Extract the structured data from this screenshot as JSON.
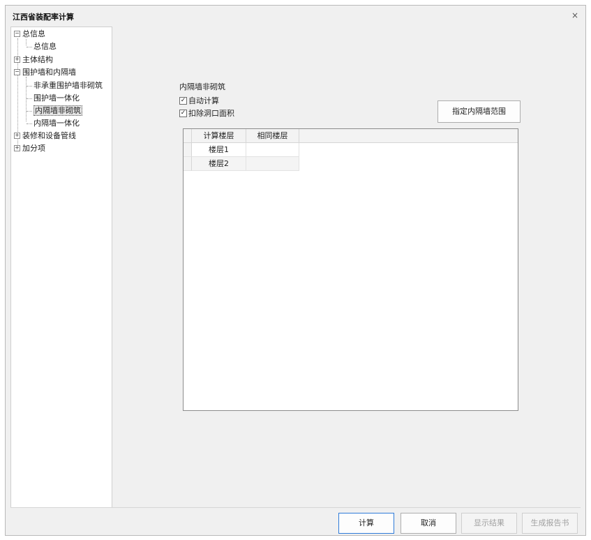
{
  "window": {
    "title": "江西省装配率计算",
    "close_glyph": "×"
  },
  "tree": {
    "items": [
      {
        "label": "总信息",
        "expander": "−"
      },
      {
        "label": "总信息"
      },
      {
        "label": "主体结构",
        "expander": "+"
      },
      {
        "label": "围护墙和内隔墙",
        "expander": "−"
      },
      {
        "label": "非承重围护墙非砌筑"
      },
      {
        "label": "围护墙一体化"
      },
      {
        "label": "内隔墙非砌筑",
        "selected": true
      },
      {
        "label": "内隔墙一体化"
      },
      {
        "label": "装修和设备管线",
        "expander": "+"
      },
      {
        "label": "加分项",
        "expander": "+"
      }
    ]
  },
  "panel": {
    "group_title": "内隔墙非砌筑",
    "auto_calc": {
      "label": "自动计算",
      "checked": true
    },
    "deduct_openings": {
      "label": "扣除洞口面积",
      "checked": true
    },
    "specify_button": "指定内隔墙范围"
  },
  "grid": {
    "columns": [
      "计算楼层",
      "相同楼层"
    ],
    "rows": [
      {
        "floor": "楼层1",
        "same": ""
      },
      {
        "floor": "楼层2",
        "same": ""
      }
    ]
  },
  "buttons": {
    "calculate": "计算",
    "cancel": "取消",
    "show_result": "显示结果",
    "generate_report": "生成报告书"
  },
  "colors": {
    "primary_border": "#2f7bd9",
    "window_bg": "#f0f0f0"
  }
}
